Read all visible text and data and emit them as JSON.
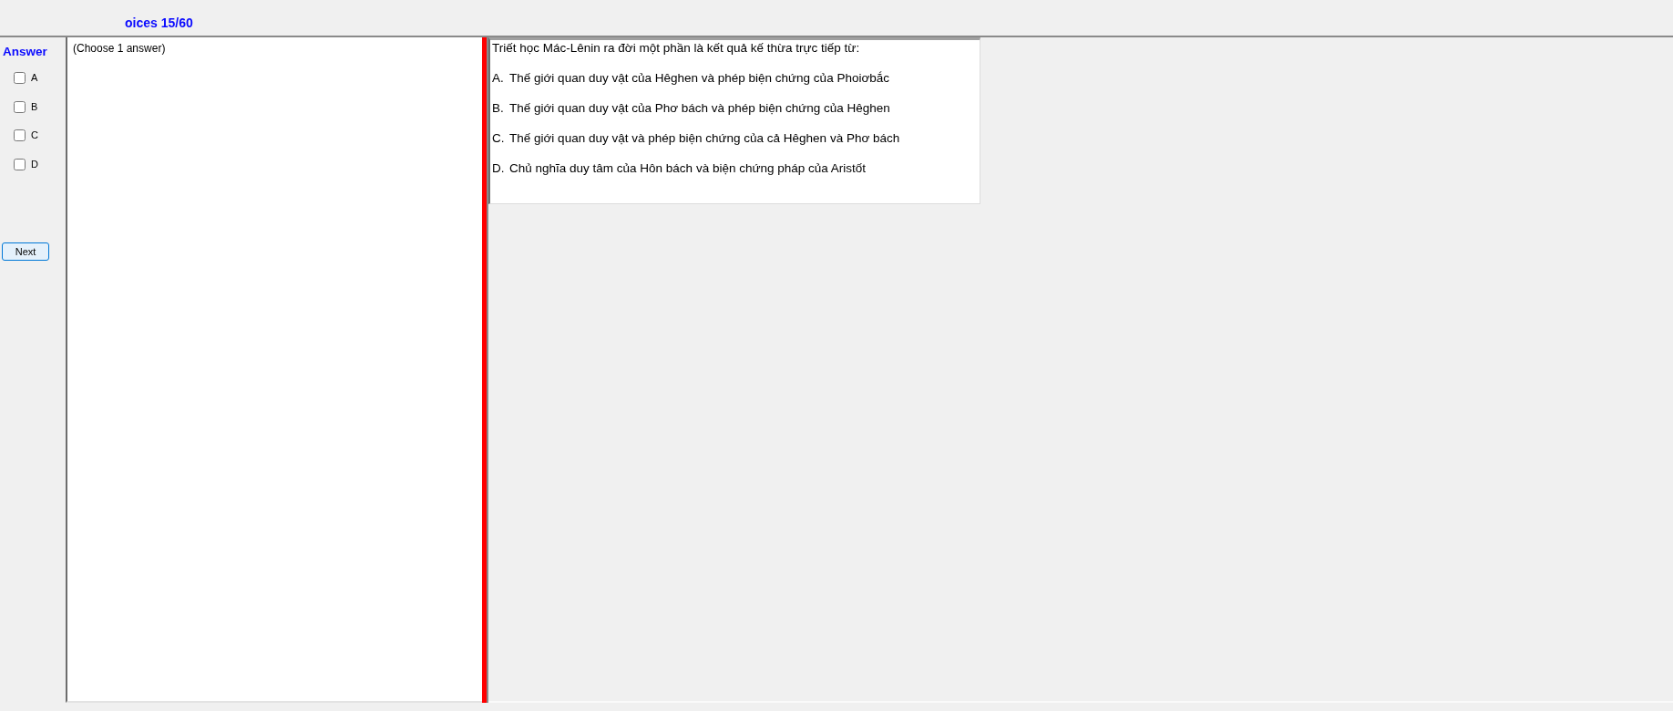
{
  "header": {
    "title": "oices 15/60"
  },
  "answer_panel": {
    "heading": "Answer",
    "options": [
      {
        "label": "A",
        "checked": false
      },
      {
        "label": "B",
        "checked": false
      },
      {
        "label": "C",
        "checked": false
      },
      {
        "label": "D",
        "checked": false
      }
    ],
    "next_button": "Next"
  },
  "instruction_panel": {
    "text": "(Choose 1 answer)"
  },
  "question_panel": {
    "question": "Triết học Mác-Lênin ra đời một phần là kết quả kế thừa trực tiếp từ:",
    "choices": [
      {
        "letter": "A.",
        "text": "Thế giới quan duy vật của Hêghen và phép biện chứng của Phoiơbắc"
      },
      {
        "letter": "B.",
        "text": "Thế giới quan duy vật của Phơ bách và phép biện chứng của Hêghen"
      },
      {
        "letter": "C.",
        "text": "Thế giới quan duy vật và phép biện chứng của cả Hêghen và Phơ bách"
      },
      {
        "letter": "D.",
        "text": "Chủ nghĩa duy tâm của Hôn bách và biện chứng pháp của Aristốt"
      }
    ]
  }
}
